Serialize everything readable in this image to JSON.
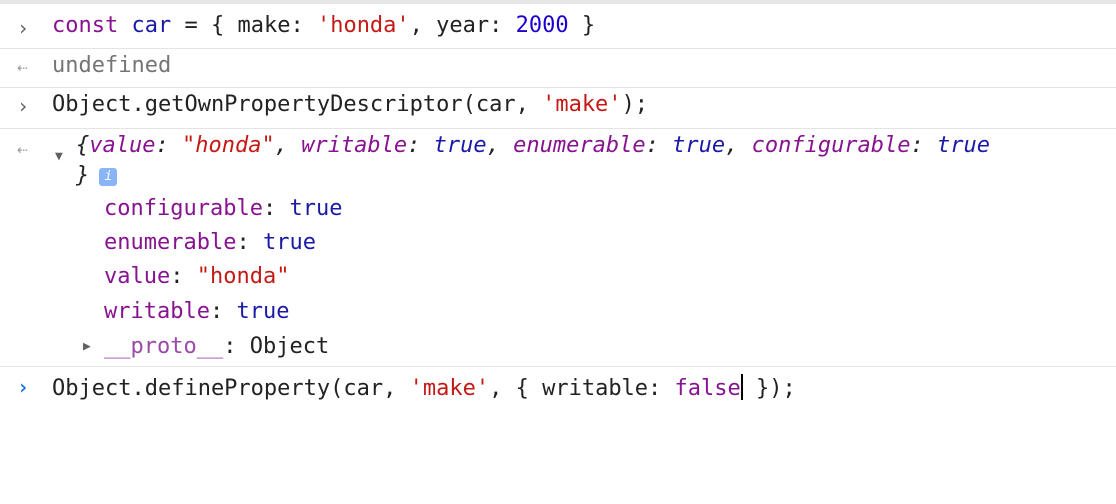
{
  "console": {
    "line1": {
      "kw": "const",
      "var": "car",
      "eq": " = { ",
      "make_key": "make",
      "colon1": ": ",
      "make_val": "'honda'",
      "comma1": ", ",
      "year_key": "year",
      "colon2": ": ",
      "year_val": "2000",
      "close": " }"
    },
    "line2": {
      "result": "undefined"
    },
    "line3": {
      "fn": "Object.getOwnPropertyDescriptor(car, ",
      "arg": "'make'",
      "close": ");"
    },
    "preview": {
      "open": "{",
      "k1": "value",
      "v1": "\"honda\"",
      "k2": "writable",
      "v2": "true",
      "k3": "enumerable",
      "v3": "true",
      "k4": "configurable",
      "v4": "true",
      "close": "}",
      "info": "i"
    },
    "props": [
      {
        "key": "configurable",
        "value": "true"
      },
      {
        "key": "enumerable",
        "value": "true"
      },
      {
        "key": "value",
        "value": "\"honda\""
      },
      {
        "key": "writable",
        "value": "true"
      }
    ],
    "proto": {
      "key": "__proto__",
      "value": "Object"
    },
    "input": {
      "fn": "Object.defineProperty(car, ",
      "arg": "'make'",
      "mid": ", { writable: ",
      "val": "false",
      "close": " });"
    }
  },
  "icons": {
    "prompt": "chevron-right-icon",
    "result": "return-arrow-icon",
    "expand": "triangle-down-icon",
    "collapse": "triangle-right-icon",
    "info": "info-icon"
  },
  "colors": {
    "keyword": "#881391",
    "string": "#c41a16",
    "number": "#1c00cf",
    "boolean": "#1a1aa6",
    "prompt_active": "#1a73e8"
  }
}
